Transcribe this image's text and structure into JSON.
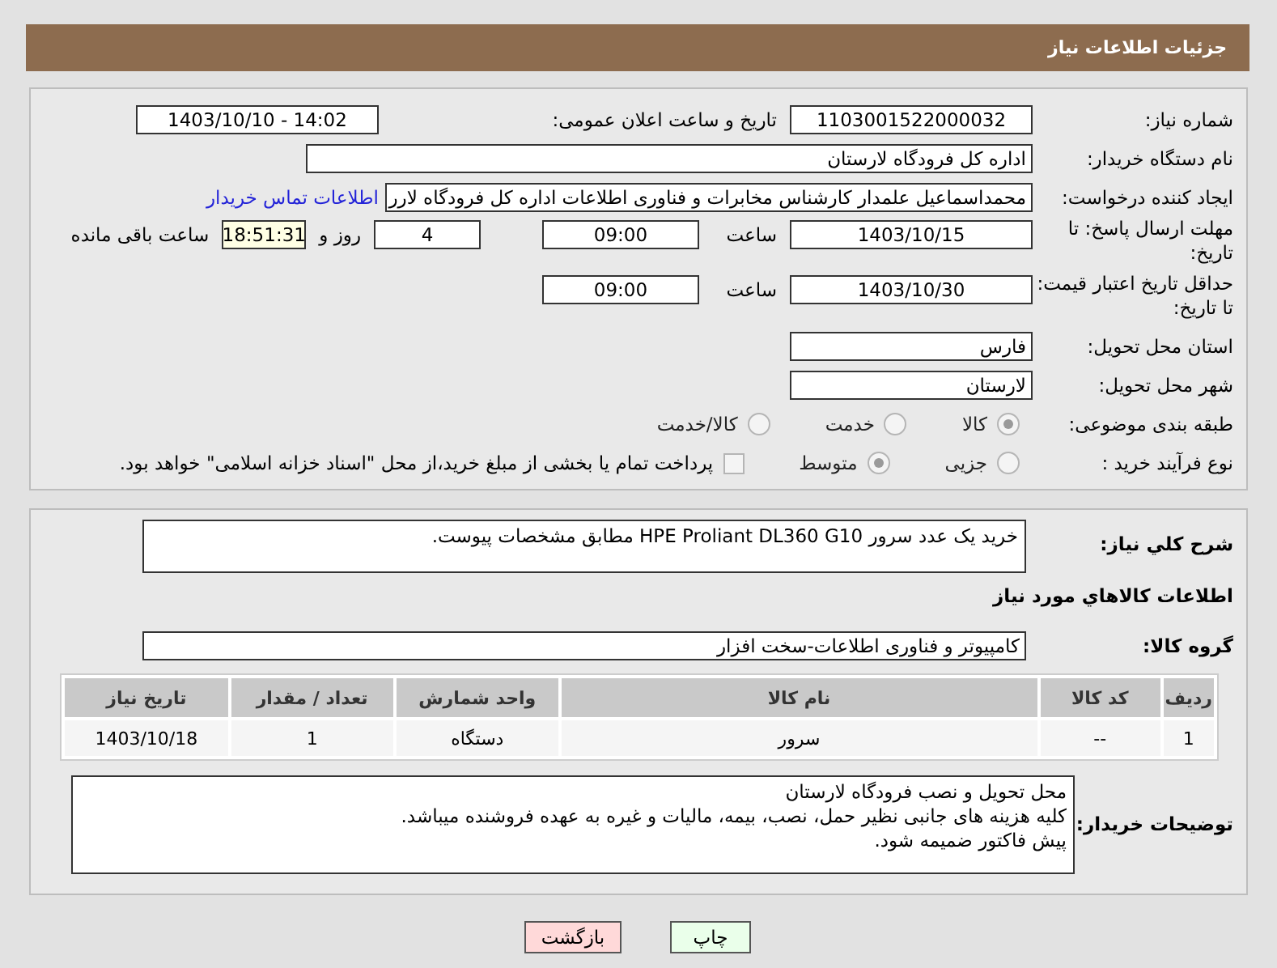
{
  "header": {
    "title": "جزئیات اطلاعات نیاز"
  },
  "need_number": {
    "label": "شماره نیاز:",
    "value": "1103001522000032"
  },
  "announce": {
    "label": "تاریخ و ساعت اعلان عمومی:",
    "value": "1403/10/10 - 14:02"
  },
  "buyer_org": {
    "label": "نام دستگاه خریدار:",
    "value": "اداره کل فرودگاه لارستان"
  },
  "creator": {
    "label": "ایجاد کننده درخواست:",
    "value": "محمداسماعیل علمدار کارشناس مخابرات و فناوری اطلاعات اداره کل فرودگاه لارر",
    "link": "اطلاعات تماس خریدار"
  },
  "reply_deadline": {
    "label": "مهلت ارسال پاسخ: تا تاریخ:",
    "date": "1403/10/15",
    "time_label": "ساعت",
    "time": "09:00",
    "days": "4",
    "days_label": "روز و",
    "remaining": "18:51:31",
    "remaining_label": "ساعت باقی مانده"
  },
  "price_validity": {
    "label": "حداقل تاریخ اعتبار قیمت: تا تاریخ:",
    "date": "1403/10/30",
    "time_label": "ساعت",
    "time": "09:00"
  },
  "province": {
    "label": "استان محل تحویل:",
    "value": "فارس"
  },
  "city": {
    "label": "شهر محل تحویل:",
    "value": "لارستان"
  },
  "category": {
    "label": "طبقه بندی موضوعی:",
    "options": [
      {
        "label": "کالا",
        "selected": true
      },
      {
        "label": "خدمت",
        "selected": false
      },
      {
        "label": "کالا/خدمت",
        "selected": false
      }
    ]
  },
  "purchase_type": {
    "label": "نوع فرآیند خرید :",
    "options": [
      {
        "label": "جزیی",
        "selected": false
      },
      {
        "label": "متوسط",
        "selected": true
      }
    ],
    "payment_checkbox": {
      "checked": false,
      "label": "پرداخت تمام یا بخشی از مبلغ خرید،از محل \"اسناد خزانه اسلامی\" خواهد بود."
    }
  },
  "description": {
    "label": "شرح کلي نياز:",
    "value": "خرید یک عدد سرور HPE Proliant DL360 G10 مطابق مشخصات پیوست."
  },
  "goods_title": "اطلاعات کالاهاي مورد نياز",
  "goods_group": {
    "label": "گروه کالا:",
    "value": "کامپیوتر و فناوری اطلاعات-سخت افزار"
  },
  "table": {
    "columns": [
      "ردیف",
      "کد کالا",
      "نام کالا",
      "واحد شمارش",
      "تعداد / مقدار",
      "تاریخ نیاز"
    ],
    "rows": [
      [
        "1",
        "--",
        "سرور",
        "دستگاه",
        "1",
        "1403/10/18"
      ]
    ]
  },
  "buyer_notes": {
    "label": "توضیحات خریدار:",
    "lines": [
      "محل تحویل و نصب فرودگاه لارستان",
      "کلیه هزینه های جانبی نظیر حمل، نصب، بیمه، مالیات و غیره به عهده فروشنده میباشد.",
      "پیش فاکتور ضمیمه شود."
    ]
  },
  "buttons": [
    {
      "label": "چاپ",
      "kind": "print"
    },
    {
      "label": "بازگشت",
      "kind": "back"
    }
  ]
}
